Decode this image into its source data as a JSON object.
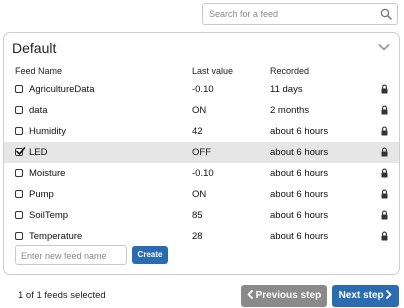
{
  "search": {
    "placeholder": "Search for a feed",
    "icon": "search-icon"
  },
  "panel": {
    "title": "Default",
    "collapse_icon": "chevron-down-icon"
  },
  "table": {
    "columns": {
      "name": "Feed Name",
      "last_value": "Last value",
      "recorded": "Recorded"
    },
    "rows": [
      {
        "name": "AgricultureData",
        "last_value": "-0.10",
        "recorded": "11 days",
        "checked": false
      },
      {
        "name": "data",
        "last_value": "ON",
        "recorded": "2 months",
        "checked": false
      },
      {
        "name": "Humidity",
        "last_value": "42",
        "recorded": "about 6 hours",
        "checked": false
      },
      {
        "name": "LED",
        "last_value": "OFF",
        "recorded": "about 6 hours",
        "checked": true
      },
      {
        "name": "Moisture",
        "last_value": "-0.10",
        "recorded": "about 6 hours",
        "checked": false
      },
      {
        "name": "Pump",
        "last_value": "ON",
        "recorded": "about 6 hours",
        "checked": false
      },
      {
        "name": "SoilTemp",
        "last_value": "85",
        "recorded": "about 6 hours",
        "checked": false
      },
      {
        "name": "Temperature",
        "last_value": "28",
        "recorded": "about 6 hours",
        "checked": false
      }
    ]
  },
  "new_feed": {
    "placeholder": "Enter new feed name",
    "create_label": "Create"
  },
  "footer": {
    "selection_text": "1 of 1 feeds selected",
    "prev_label": "Previous step",
    "next_label": "Next step"
  },
  "colors": {
    "primary": "#2b6cb0",
    "disabled": "#8a8a8a",
    "selected_row": "#e6e6e6"
  }
}
